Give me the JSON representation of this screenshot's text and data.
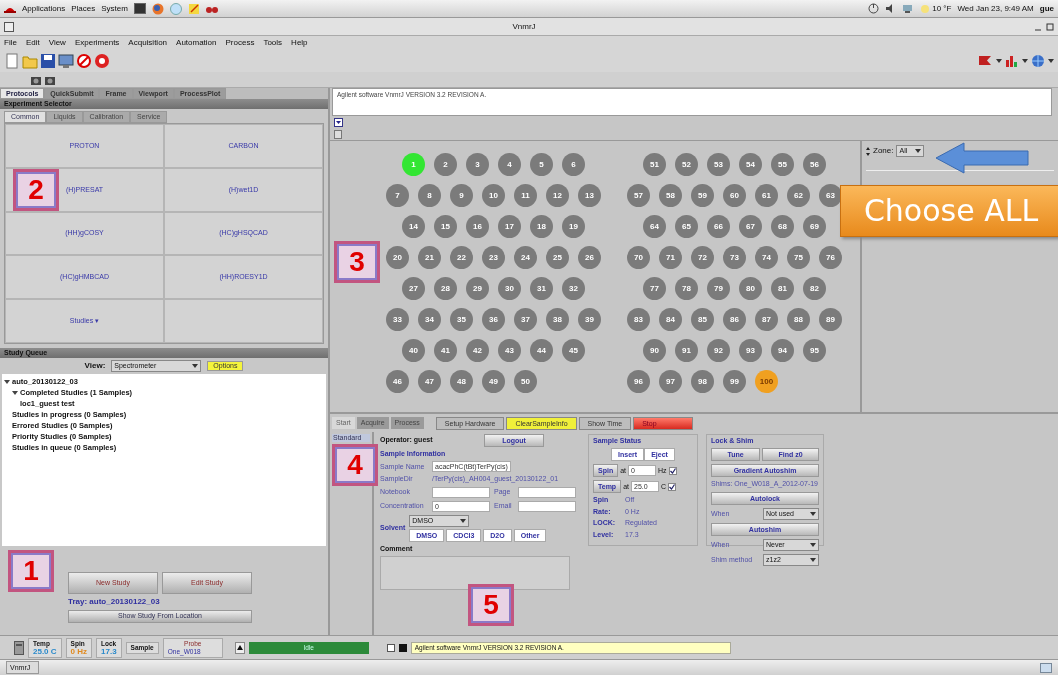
{
  "top_panel": {
    "menus": [
      "Applications",
      "Places",
      "System"
    ],
    "weather": "10 °F",
    "clock": "Wed Jan 23,  9:49 AM",
    "user": "gue"
  },
  "window": {
    "title": "VnmrJ"
  },
  "menu": [
    "File",
    "Edit",
    "View",
    "Experiments",
    "Acquisition",
    "Automation",
    "Process",
    "Tools",
    "Help"
  ],
  "left_tabs": [
    {
      "label": "Protocols",
      "selected": true
    },
    {
      "label": "QuickSubmit",
      "selected": false
    },
    {
      "label": "Frame",
      "selected": false
    },
    {
      "label": "Viewport",
      "selected": false
    },
    {
      "label": "ProcessPlot",
      "selected": false
    }
  ],
  "experiment_selector": {
    "title": "Experiment Selector",
    "tabs": [
      {
        "label": "Common",
        "selected": true
      },
      {
        "label": "Liquids",
        "selected": false
      },
      {
        "label": "Calibration",
        "selected": false
      },
      {
        "label": "Service",
        "selected": false
      }
    ],
    "buttons": [
      "PROTON",
      "CARBON",
      "(H)PRESAT",
      "(H)wet1D",
      "(HH)gCOSY",
      "(HC)gHSQCAD",
      "(HC)gHMBCAD",
      "(HH)ROESY1D",
      "Studies ▾"
    ]
  },
  "study_queue": {
    "title": "Study Queue",
    "view_label": "View:",
    "view_value": "Spectrometer",
    "options": "Options",
    "tree": [
      {
        "label": "auto_20130122_03",
        "expanded": true,
        "children": [
          {
            "label": "Completed Studies (1 Samples)",
            "expanded": true,
            "children": [
              {
                "label": "loc1_guest test"
              }
            ]
          },
          {
            "label": "Studies in progress (0 Samples)"
          },
          {
            "label": "Errored Studies (0 Samples)"
          },
          {
            "label": "Priority Studies (0 Samples)"
          },
          {
            "label": "Studies in queue (0 Samples)"
          }
        ]
      }
    ],
    "buttons": [
      "New Study",
      "Edit Study"
    ],
    "tray": "Tray: auto_20130122_03",
    "show_location": "Show Study From Location"
  },
  "message": "Agilent software VnmrJ VERSION 3.2 REVISION A.",
  "sample_tray": {
    "racks": [
      {
        "rows": [
          [
            {
              "label": "1",
              "color": "#33e633"
            },
            {
              "label": "2",
              "color": "#7b7b7b"
            },
            {
              "label": "3",
              "color": "#7b7b7b"
            },
            {
              "label": "4",
              "color": "#7b7b7b"
            },
            {
              "label": "5",
              "color": "#7b7b7b"
            },
            {
              "label": "6",
              "color": "#7b7b7b"
            }
          ],
          [
            {
              "label": "7",
              "color": "#7b7b7b"
            },
            {
              "label": "8",
              "color": "#7b7b7b"
            },
            {
              "label": "9",
              "color": "#7b7b7b"
            },
            {
              "label": "10",
              "color": "#7b7b7b"
            },
            {
              "label": "11",
              "color": "#7b7b7b"
            },
            {
              "label": "12",
              "color": "#7b7b7b"
            },
            {
              "label": "13",
              "color": "#7b7b7b"
            }
          ],
          [
            {
              "label": "14",
              "color": "#7b7b7b"
            },
            {
              "label": "15",
              "color": "#7b7b7b"
            },
            {
              "label": "16",
              "color": "#7b7b7b"
            },
            {
              "label": "17",
              "color": "#7b7b7b"
            },
            {
              "label": "18",
              "color": "#7b7b7b"
            },
            {
              "label": "19",
              "color": "#7b7b7b"
            }
          ],
          [
            {
              "label": "20",
              "color": "#7b7b7b"
            },
            {
              "label": "21",
              "color": "#7b7b7b"
            },
            {
              "label": "22",
              "color": "#7b7b7b"
            },
            {
              "label": "23",
              "color": "#7b7b7b"
            },
            {
              "label": "24",
              "color": "#7b7b7b"
            },
            {
              "label": "25",
              "color": "#7b7b7b"
            },
            {
              "label": "26",
              "color": "#7b7b7b"
            }
          ],
          [
            {
              "label": "27",
              "color": "#7b7b7b"
            },
            {
              "label": "28",
              "color": "#7b7b7b"
            },
            {
              "label": "29",
              "color": "#7b7b7b"
            },
            {
              "label": "30",
              "color": "#7b7b7b"
            },
            {
              "label": "31",
              "color": "#7b7b7b"
            },
            {
              "label": "32",
              "color": "#7b7b7b"
            }
          ],
          [
            {
              "label": "33",
              "color": "#7b7b7b"
            },
            {
              "label": "34",
              "color": "#7b7b7b"
            },
            {
              "label": "35",
              "color": "#7b7b7b"
            },
            {
              "label": "36",
              "color": "#7b7b7b"
            },
            {
              "label": "37",
              "color": "#7b7b7b"
            },
            {
              "label": "38",
              "color": "#7b7b7b"
            },
            {
              "label": "39",
              "color": "#7b7b7b"
            }
          ],
          [
            {
              "label": "40",
              "color": "#7b7b7b"
            },
            {
              "label": "41",
              "color": "#7b7b7b"
            },
            {
              "label": "42",
              "color": "#7b7b7b"
            },
            {
              "label": "43",
              "color": "#7b7b7b"
            },
            {
              "label": "44",
              "color": "#7b7b7b"
            },
            {
              "label": "45",
              "color": "#7b7b7b"
            }
          ],
          [
            {
              "label": "46",
              "color": "#7b7b7b"
            },
            {
              "label": "47",
              "color": "#7b7b7b"
            },
            {
              "label": "48",
              "color": "#7b7b7b"
            },
            {
              "label": "49",
              "color": "#7b7b7b"
            },
            {
              "label": "50",
              "color": "#7b7b7b"
            }
          ]
        ]
      },
      {
        "rows": [
          [
            {
              "label": "51",
              "color": "#7b7b7b"
            },
            {
              "label": "52",
              "color": "#7b7b7b"
            },
            {
              "label": "53",
              "color": "#7b7b7b"
            },
            {
              "label": "54",
              "color": "#7b7b7b"
            },
            {
              "label": "55",
              "color": "#7b7b7b"
            },
            {
              "label": "56",
              "color": "#7b7b7b"
            }
          ],
          [
            {
              "label": "57",
              "color": "#7b7b7b"
            },
            {
              "label": "58",
              "color": "#7b7b7b"
            },
            {
              "label": "59",
              "color": "#7b7b7b"
            },
            {
              "label": "60",
              "color": "#7b7b7b"
            },
            {
              "label": "61",
              "color": "#7b7b7b"
            },
            {
              "label": "62",
              "color": "#7b7b7b"
            },
            {
              "label": "63",
              "color": "#7b7b7b"
            }
          ],
          [
            {
              "label": "64",
              "color": "#7b7b7b"
            },
            {
              "label": "65",
              "color": "#7b7b7b"
            },
            {
              "label": "66",
              "color": "#7b7b7b"
            },
            {
              "label": "67",
              "color": "#7b7b7b"
            },
            {
              "label": "68",
              "color": "#7b7b7b"
            },
            {
              "label": "69",
              "color": "#7b7b7b"
            }
          ],
          [
            {
              "label": "70",
              "color": "#7b7b7b"
            },
            {
              "label": "71",
              "color": "#7b7b7b"
            },
            {
              "label": "72",
              "color": "#7b7b7b"
            },
            {
              "label": "73",
              "color": "#7b7b7b"
            },
            {
              "label": "74",
              "color": "#7b7b7b"
            },
            {
              "label": "75",
              "color": "#7b7b7b"
            },
            {
              "label": "76",
              "color": "#7b7b7b"
            }
          ],
          [
            {
              "label": "77",
              "color": "#7b7b7b"
            },
            {
              "label": "78",
              "color": "#7b7b7b"
            },
            {
              "label": "79",
              "color": "#7b7b7b"
            },
            {
              "label": "80",
              "color": "#7b7b7b"
            },
            {
              "label": "81",
              "color": "#7b7b7b"
            },
            {
              "label": "82",
              "color": "#7b7b7b"
            }
          ],
          [
            {
              "label": "83",
              "color": "#7b7b7b"
            },
            {
              "label": "84",
              "color": "#7b7b7b"
            },
            {
              "label": "85",
              "color": "#7b7b7b"
            },
            {
              "label": "86",
              "color": "#7b7b7b"
            },
            {
              "label": "87",
              "color": "#7b7b7b"
            },
            {
              "label": "88",
              "color": "#7b7b7b"
            },
            {
              "label": "89",
              "color": "#7b7b7b"
            }
          ],
          [
            {
              "label": "90",
              "color": "#7b7b7b"
            },
            {
              "label": "91",
              "color": "#7b7b7b"
            },
            {
              "label": "92",
              "color": "#7b7b7b"
            },
            {
              "label": "93",
              "color": "#7b7b7b"
            },
            {
              "label": "94",
              "color": "#7b7b7b"
            },
            {
              "label": "95",
              "color": "#7b7b7b"
            }
          ],
          [
            {
              "label": "96",
              "color": "#7b7b7b"
            },
            {
              "label": "97",
              "color": "#7b7b7b"
            },
            {
              "label": "98",
              "color": "#7b7b7b"
            },
            {
              "label": "99",
              "color": "#7b7b7b"
            },
            {
              "label": "100",
              "color": "#f0a020"
            }
          ]
        ]
      }
    ],
    "zone_label": "Zone:",
    "zone_value": "All"
  },
  "callout": {
    "text": "Choose ALL"
  },
  "annotations": [
    "1",
    "2",
    "3",
    "4",
    "5"
  ],
  "bottom_tabs": [
    {
      "label": "Start",
      "selected": true
    },
    {
      "label": "Acquire",
      "selected": false
    },
    {
      "label": "Process",
      "selected": false
    }
  ],
  "action_buttons": [
    {
      "label": "Setup Hardware",
      "kind": "plain"
    },
    {
      "label": "ClearSampleInfo",
      "kind": "highlight"
    },
    {
      "label": "Show Time",
      "kind": "plain"
    },
    {
      "label": "Stop",
      "kind": "danger"
    }
  ],
  "side_tabs": [
    {
      "label": "Standard",
      "selected": true
    }
  ],
  "operator": {
    "label": "Operator: guest",
    "logout": "Logout"
  },
  "sample_info": {
    "title": "Sample Information",
    "rows": [
      [
        {
          "label": "Sample Name",
          "kind": "input",
          "value": "acacPhC(tBt)TerPy(cis)"
        }
      ],
      [
        {
          "label": "SampleDir",
          "kind": "text",
          "value": "/TerPy(cis)_AH004_guest_20130122_01"
        }
      ],
      [
        {
          "label": "Notebook",
          "kind": "input"
        },
        {
          "label": "Page",
          "kind": "input"
        }
      ],
      [
        {
          "label": "Concentration",
          "kind": "input",
          "value": "0"
        },
        {
          "label": "Email",
          "kind": "input"
        }
      ]
    ],
    "solvent_label": "Solvent",
    "solvent_value": "DMSO",
    "solvents": [
      "DMSO",
      "CDCl3",
      "D2O",
      "Other"
    ],
    "comment_label": "Comment"
  },
  "sample_status": {
    "title": "Sample Status",
    "buttons": [
      "Insert",
      "Eject"
    ],
    "controls": [
      {
        "label": "Spin",
        "at": "at",
        "value": "0",
        "unit": "Hz",
        "checked": true
      },
      {
        "label": "Temp",
        "at": "at",
        "value": "25.0",
        "unit": "C",
        "checked": true
      }
    ],
    "readings": [
      {
        "label": "Spin",
        "value": "Off"
      },
      {
        "label": "Rate:",
        "value": "0 Hz"
      },
      {
        "label": "LOCK:",
        "value": "Regulated"
      },
      {
        "label": "Level:",
        "value": "17.3"
      }
    ]
  },
  "lock_shim": {
    "title": "Lock & Shim",
    "tune": "Tune",
    "find_z0": "Find z0",
    "gradient": "Gradient Autoshim",
    "shims": "Shims: One_W018_A_2012-07-19",
    "autolock": "Autolock",
    "autolock_when_label": "When",
    "autolock_when": "Not used",
    "autoshim": "Autoshim",
    "autoshim_when_label": "When",
    "autoshim_when": "Never",
    "method_label": "Shim method",
    "method": "z1z2"
  },
  "status_bar": {
    "items": [
      {
        "label": "Temp",
        "value": "25.0 C",
        "color": "#2a8acb"
      },
      {
        "label": "Spin",
        "value": "0 Hz",
        "color": "#e08a20"
      },
      {
        "label": "Lock",
        "value": "17.3",
        "color": "#2a8acb"
      },
      {
        "label": "Sample"
      }
    ],
    "probe": "Probe",
    "probe_value": "One_W018",
    "state": "Idle",
    "message": "Agilent software VnmrJ VERSION 3.2 REVISION A."
  },
  "taskbar": {
    "item": "VnmrJ"
  }
}
